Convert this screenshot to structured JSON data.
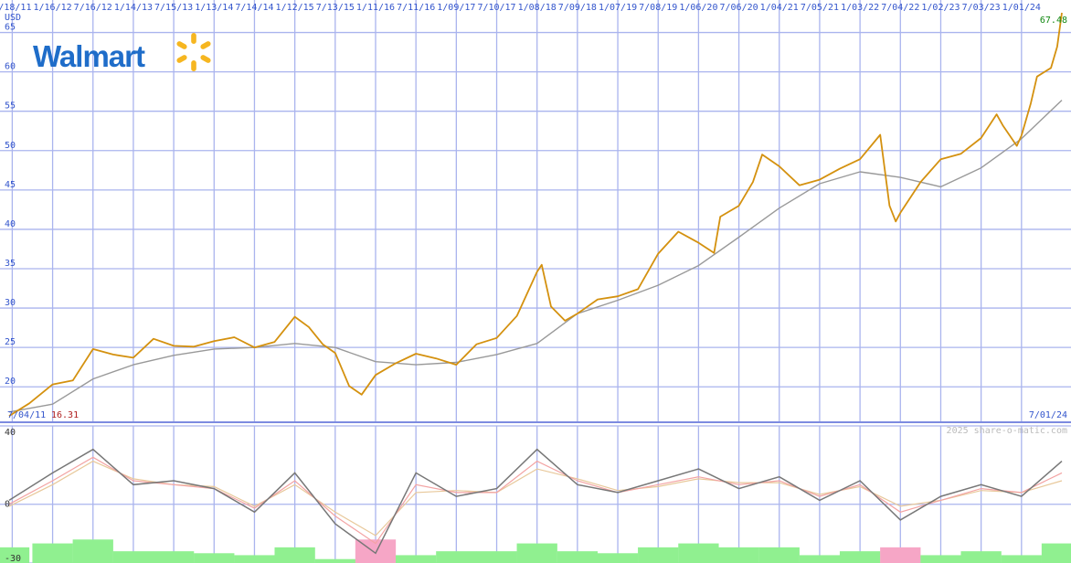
{
  "company_logo": {
    "text": "Walmart",
    "brand_color": "#1f6dc9",
    "spark_color": "#f6b620",
    "icon": "walmart-spark-icon"
  },
  "footer": {
    "watermark": "2025 share-o-matic.com"
  },
  "chart_data": [
    {
      "type": "line",
      "currency_label": "USD",
      "x_tick_labels": [
        "7/18/11",
        "1/16/12",
        "7/16/12",
        "1/14/13",
        "7/15/13",
        "1/13/14",
        "7/14/14",
        "1/12/15",
        "7/13/15",
        "1/11/16",
        "7/11/16",
        "1/09/17",
        "7/10/17",
        "1/08/18",
        "7/09/18",
        "1/07/19",
        "7/08/19",
        "1/06/20",
        "7/06/20",
        "1/04/21",
        "7/05/21",
        "1/03/22",
        "7/04/22",
        "1/02/23",
        "7/03/23",
        "1/01/24"
      ],
      "y_ticks": [
        20,
        25,
        30,
        35,
        40,
        45,
        50,
        55,
        60,
        65
      ],
      "ylim": [
        15.5,
        67.5
      ],
      "start_date": "7/04/11",
      "start_value": 16.31,
      "end_date": "7/01/24",
      "end_value": 67.48,
      "series": [
        {
          "color": "#d4910f",
          "x": [
            "7/04/11",
            "10/03/11",
            "1/16/12",
            "4/16/12",
            "7/16/12",
            "10/15/12",
            "1/14/13",
            "4/15/13",
            "7/15/13",
            "10/14/13",
            "1/13/14",
            "4/14/14",
            "7/14/14",
            "10/13/14",
            "1/12/15",
            "3/16/15",
            "5/18/15",
            "7/13/15",
            "9/14/15",
            "11/09/15",
            "1/11/16",
            "4/11/16",
            "7/11/16",
            "10/10/16",
            "1/09/17",
            "4/10/17",
            "7/10/17",
            "10/09/17",
            "1/08/18",
            "1/29/18",
            "3/12/18",
            "5/14/18",
            "7/09/18",
            "10/08/18",
            "1/07/19",
            "4/08/19",
            "7/08/19",
            "10/07/19",
            "1/06/20",
            "3/16/20",
            "4/13/20",
            "7/06/20",
            "9/07/20",
            "10/19/20",
            "1/04/21",
            "4/05/21",
            "7/05/21",
            "10/04/21",
            "1/03/22",
            "4/04/22",
            "5/16/22",
            "6/13/22",
            "7/04/22",
            "10/03/22",
            "1/02/23",
            "4/03/23",
            "7/03/23",
            "9/11/23",
            "10/09/23",
            "12/11/23",
            "1/01/24",
            "2/12/24",
            "3/11/24",
            "5/13/24",
            "6/10/24",
            "7/01/24"
          ],
          "values": [
            16.3,
            17.9,
            20.3,
            20.8,
            24.8,
            24.1,
            23.7,
            26.1,
            25.2,
            25.1,
            25.8,
            26.3,
            25.0,
            25.7,
            28.9,
            27.6,
            25.4,
            24.3,
            20.1,
            19.0,
            21.5,
            23.0,
            24.2,
            23.6,
            22.8,
            25.4,
            26.2,
            29.0,
            34.6,
            35.5,
            30.2,
            28.4,
            29.3,
            31.1,
            31.5,
            32.4,
            36.9,
            39.7,
            38.3,
            37.0,
            41.6,
            43.0,
            46.0,
            49.5,
            48.0,
            45.6,
            46.3,
            47.7,
            48.9,
            52.0,
            43.0,
            41.0,
            42.1,
            46.0,
            48.9,
            49.6,
            51.6,
            54.6,
            53.2,
            50.6,
            51.9,
            56.0,
            59.4,
            60.5,
            63.2,
            67.5
          ]
        },
        {
          "color": "#999999",
          "x": [
            "7/04/11",
            "1/16/12",
            "7/16/12",
            "1/14/13",
            "7/15/13",
            "1/13/14",
            "7/14/14",
            "1/12/15",
            "7/13/15",
            "1/11/16",
            "7/11/16",
            "1/09/17",
            "7/10/17",
            "1/08/18",
            "7/09/18",
            "1/07/19",
            "7/08/19",
            "1/06/20",
            "7/06/20",
            "1/04/21",
            "7/05/21",
            "1/03/22",
            "7/04/22",
            "1/02/23",
            "7/03/23",
            "1/01/24",
            "7/01/24"
          ],
          "values": [
            16.8,
            17.8,
            21.0,
            22.8,
            24.0,
            24.8,
            25.0,
            25.5,
            25.0,
            23.2,
            22.8,
            23.1,
            24.1,
            25.5,
            29.3,
            31.0,
            32.9,
            35.4,
            39.0,
            42.7,
            45.8,
            47.3,
            46.6,
            45.4,
            47.8,
            51.5,
            56.4
          ]
        }
      ]
    },
    {
      "type": "line",
      "y_ticks": [
        -30,
        0,
        40
      ],
      "ylim": [
        -30,
        40
      ],
      "x": [
        "7/04/11",
        "1/16/12",
        "7/16/12",
        "1/14/13",
        "7/15/13",
        "1/13/14",
        "7/14/14",
        "1/12/15",
        "7/13/15",
        "1/11/16",
        "7/11/16",
        "1/09/17",
        "7/10/17",
        "1/08/18",
        "7/09/18",
        "1/07/19",
        "7/08/19",
        "1/06/20",
        "7/06/20",
        "1/04/21",
        "7/05/21",
        "1/03/22",
        "7/04/22",
        "1/02/23",
        "7/03/23",
        "1/01/24",
        "7/01/24"
      ],
      "series": [
        {
          "color": "#777777",
          "values": [
            2,
            16,
            28,
            10,
            12,
            8,
            -4,
            16,
            -10,
            -25,
            16,
            4,
            8,
            28,
            10,
            6,
            12,
            18,
            8,
            14,
            2,
            12,
            -8,
            4,
            10,
            4,
            22
          ]
        },
        {
          "color": "#f3a3a3",
          "values": [
            0,
            12,
            24,
            12,
            10,
            8,
            -2,
            12,
            -6,
            -20,
            10,
            6,
            6,
            22,
            12,
            6,
            10,
            14,
            10,
            12,
            4,
            10,
            -4,
            2,
            8,
            6,
            16
          ]
        },
        {
          "color": "#e8c89a",
          "values": [
            -1,
            10,
            22,
            13,
            10,
            9,
            -1,
            10,
            -4,
            -16,
            6,
            7,
            6,
            18,
            13,
            7,
            9,
            13,
            11,
            11,
            5,
            9,
            -1,
            2,
            7,
            6,
            12
          ]
        }
      ],
      "bars": {
        "positive_color": "#90f090",
        "negative_color": "#f6a6c6",
        "values": [
          8,
          10,
          12,
          6,
          6,
          5,
          4,
          8,
          2,
          -12,
          4,
          6,
          6,
          10,
          6,
          5,
          8,
          10,
          8,
          8,
          4,
          6,
          -8,
          4,
          6,
          4,
          10
        ]
      }
    }
  ]
}
